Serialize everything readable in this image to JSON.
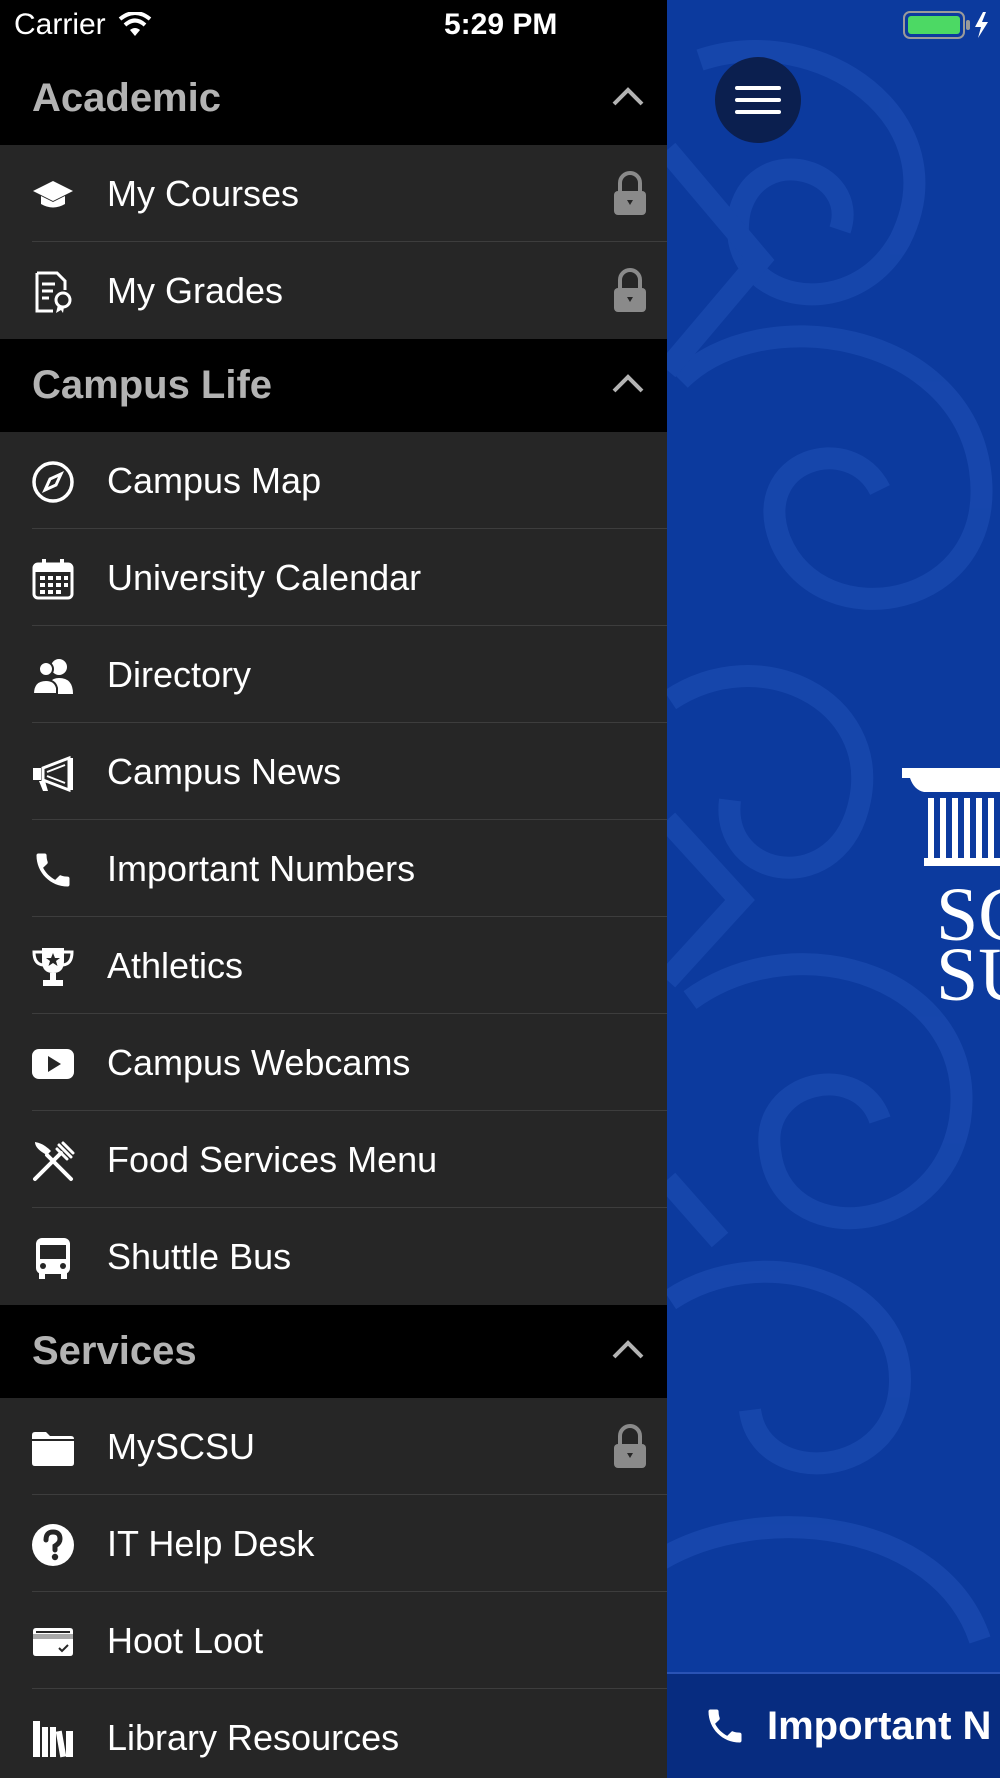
{
  "status_bar": {
    "carrier": "Carrier",
    "time": "5:29 PM"
  },
  "sections": [
    {
      "title": "Academic",
      "items": [
        {
          "label": "My Courses",
          "icon": "graduation-cap-icon",
          "locked": true
        },
        {
          "label": "My Grades",
          "icon": "certificate-document-icon",
          "locked": true
        }
      ]
    },
    {
      "title": "Campus Life",
      "items": [
        {
          "label": "Campus Map",
          "icon": "compass-icon",
          "locked": false
        },
        {
          "label": "University Calendar",
          "icon": "calendar-icon",
          "locked": false
        },
        {
          "label": "Directory",
          "icon": "users-icon",
          "locked": false
        },
        {
          "label": "Campus News",
          "icon": "megaphone-icon",
          "locked": false
        },
        {
          "label": "Important Numbers",
          "icon": "phone-icon",
          "locked": false
        },
        {
          "label": "Athletics",
          "icon": "trophy-icon",
          "locked": false
        },
        {
          "label": "Campus Webcams",
          "icon": "play-video-icon",
          "locked": false
        },
        {
          "label": "Food Services Menu",
          "icon": "utensils-icon",
          "locked": false
        },
        {
          "label": "Shuttle Bus",
          "icon": "bus-icon",
          "locked": false
        }
      ]
    },
    {
      "title": "Services",
      "items": [
        {
          "label": "MySCSU",
          "icon": "folder-icon",
          "locked": true
        },
        {
          "label": "IT Help Desk",
          "icon": "question-circle-icon",
          "locked": false
        },
        {
          "label": "Hoot Loot",
          "icon": "credit-card-icon",
          "locked": false
        },
        {
          "label": "Library Resources",
          "icon": "books-icon",
          "locked": false
        }
      ]
    }
  ],
  "main": {
    "bottom_bar_label": "Important N",
    "logo_text_line1": "SC",
    "logo_text_line2": "SU"
  },
  "colors": {
    "drawer_bg": "#262626",
    "section_header_bg": "#000000",
    "main_bg": "#0c3a9e",
    "battery": "#4cd964"
  }
}
